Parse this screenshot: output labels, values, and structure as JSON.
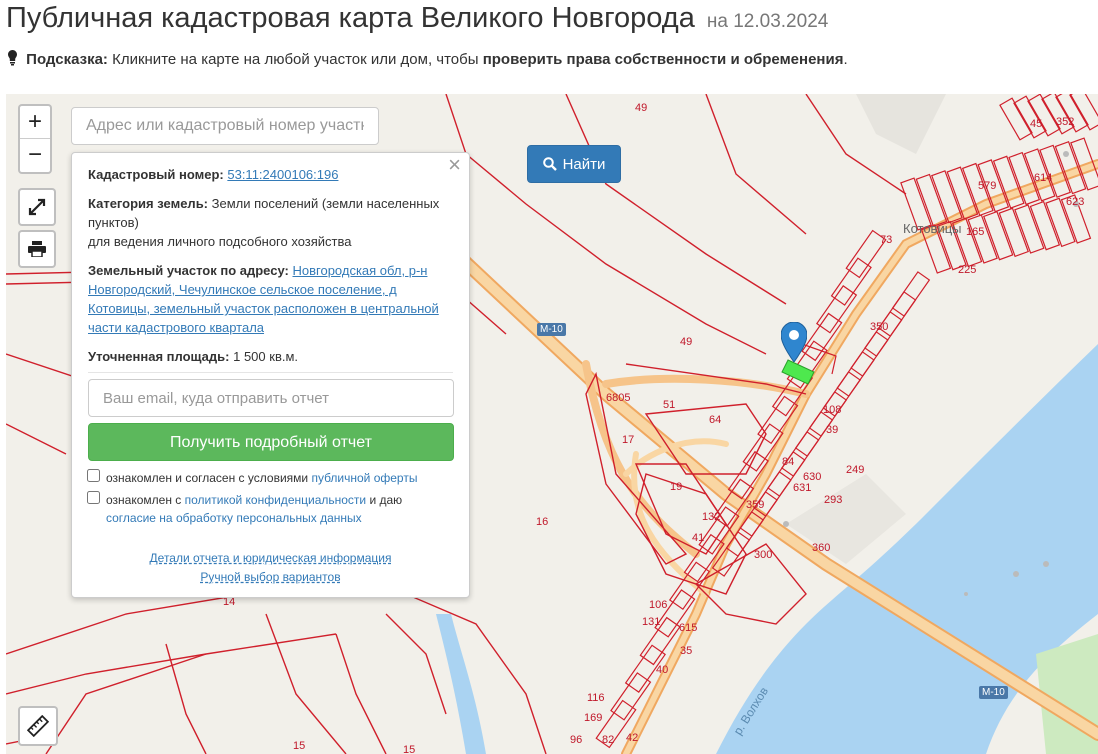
{
  "header": {
    "title": "Публичная кадастровая карта Великого Новгорода",
    "date": "на 12.03.2024"
  },
  "hint": {
    "prefix": "Подсказка:",
    "text": "Кликните на карте на любой участок или дом, чтобы",
    "bold": "проверить права собственности и обременения",
    "suffix": "."
  },
  "map": {
    "search_placeholder": "Адрес или кадастровый номер участка",
    "find_label": "Найти",
    "zoom_in": "+",
    "zoom_out": "−",
    "icons": [
      "search-icon",
      "fullscreen-icon",
      "print-icon",
      "ruler-icon",
      "map-marker-icon",
      "close-icon",
      "lightbulb-icon"
    ],
    "road_shields": [
      "М-10",
      "М-10"
    ],
    "water_label": "р. Волхов",
    "village_label": "Котовицы",
    "parcel_labels": [
      "49",
      "49",
      "51",
      "64",
      "6805",
      "17",
      "19",
      "132",
      "41",
      "359",
      "300",
      "360",
      "16",
      "14",
      "15",
      "15",
      "106",
      "131",
      "615",
      "35",
      "40",
      "116",
      "169",
      "96",
      "82",
      "42",
      "108",
      "39",
      "84",
      "630",
      "249",
      "631",
      "293",
      "350",
      "73",
      "579",
      "165",
      "225",
      "614",
      "623",
      "45",
      "352"
    ]
  },
  "popup": {
    "cadastral_label": "Кадастровый номер:",
    "cadastral_value": "53:11:2400106:196",
    "category_label": "Категория земель:",
    "category_value": "Земли поселений (земли населенных пунктов)",
    "use_value": "для ведения личного подсобного хозяйства",
    "address_label": "Земельный участок по адресу:",
    "address_value": "Новгородская обл, р-н Новгородский, Чечулинское сельское поселение, д Котовицы, земельный участок расположен в центральной части кадастрового квартала",
    "area_label": "Уточненная площадь:",
    "area_value": "1 500 кв.м.",
    "email_placeholder": "Ваш email, куда отправить отчет",
    "get_report": "Получить подробный отчет",
    "chk1_text": "ознакомлен и согласен с условиями",
    "chk1_link": "публичной оферты",
    "chk2_text": "ознакомлен с",
    "chk2_link": "политикой конфиденциальности",
    "chk2_mid": "и даю",
    "chk2_link2": "согласие на обработку персональных данных",
    "details_link": "Детали отчета и юридическая информация",
    "manual_link": "Ручной выбор вариантов"
  },
  "colors": {
    "parcel": "#d0202c",
    "water": "#aad3f2",
    "road": "#f7c28a",
    "find_btn": "#337ab7",
    "report_btn": "#5cb85c",
    "highlight": "#4ee84e"
  }
}
